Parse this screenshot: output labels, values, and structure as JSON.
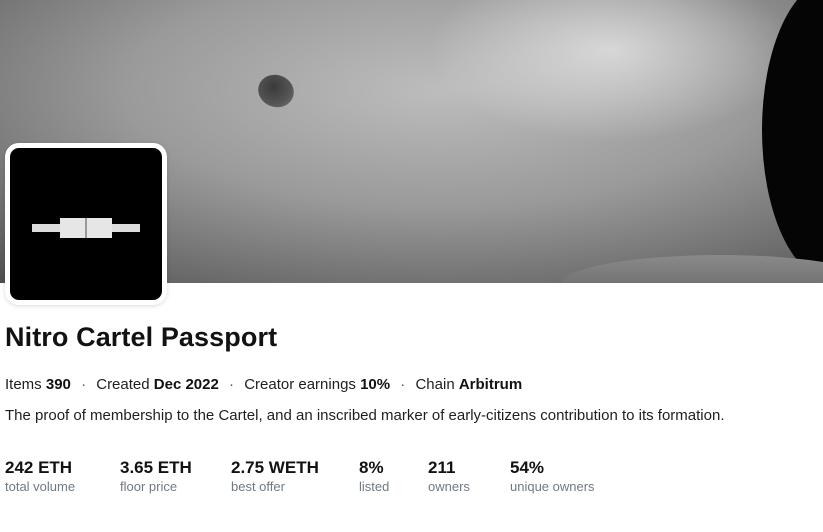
{
  "collection": {
    "name": "Nitro Cartel Passport",
    "meta": {
      "items_label": "Items",
      "items_value": "390",
      "created_label": "Created",
      "created_value": "Dec 2022",
      "earnings_label": "Creator earnings",
      "earnings_value": "10%",
      "chain_label": "Chain",
      "chain_value": "Arbitrum",
      "separator": "·"
    },
    "description": "The proof of membership to the Cartel, and an inscribed marker of early-citizens contribution to its formation."
  },
  "stats": [
    {
      "value": "242 ETH",
      "label": "total volume"
    },
    {
      "value": "3.65 ETH",
      "label": "floor price"
    },
    {
      "value": "2.75 WETH",
      "label": "best offer"
    },
    {
      "value": "8%",
      "label": "listed"
    },
    {
      "value": "211",
      "label": "owners"
    },
    {
      "value": "54%",
      "label": "unique owners"
    }
  ],
  "colors": {
    "text": "#121212",
    "muted": "#707a83",
    "avatar_bg": "#000000"
  }
}
